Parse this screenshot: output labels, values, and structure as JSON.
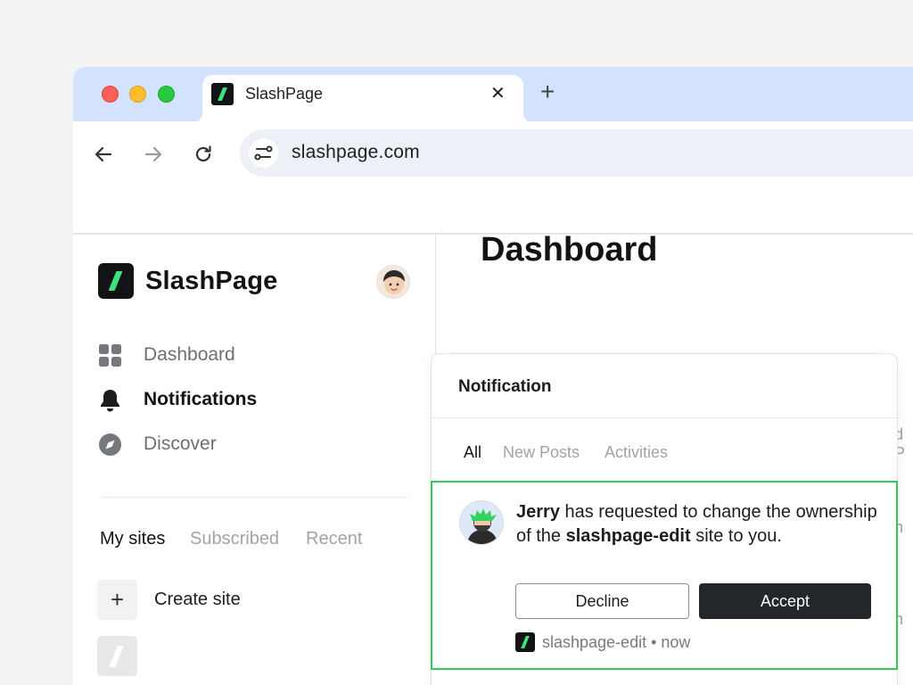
{
  "browser": {
    "tab_title": "SlashPage",
    "tab_close": "✕",
    "new_tab": "+",
    "url": "slashpage.com"
  },
  "sidebar": {
    "brand": "SlashPage",
    "nav": [
      {
        "label": "Dashboard",
        "icon": "grid-icon",
        "active": false
      },
      {
        "label": "Notifications",
        "icon": "bell-icon",
        "active": true
      },
      {
        "label": "Discover",
        "icon": "compass-icon",
        "active": false
      }
    ],
    "site_tabs": [
      {
        "label": "My sites",
        "active": true
      },
      {
        "label": "Subscribed",
        "active": false
      },
      {
        "label": "Recent",
        "active": false
      }
    ],
    "create_icon": "+",
    "create_label": "Create site"
  },
  "main": {
    "title": "Dashboard",
    "edge_fragments": [
      "d P",
      "n",
      "n"
    ]
  },
  "notifications": {
    "title": "Notification",
    "tabs": [
      {
        "label": "All",
        "active": true
      },
      {
        "label": "New Posts",
        "active": false
      },
      {
        "label": "Activities",
        "active": false
      }
    ],
    "item": {
      "user": "Jerry",
      "text_1": " has requested to change the ownership of the ",
      "site": "slashpage-edit",
      "text_2": " site to you.",
      "decline_label": "Decline",
      "accept_label": "Accept",
      "meta": "slashpage-edit • now"
    }
  },
  "colors": {
    "accent_green": "#3ee27a",
    "highlight_border": "#35c95a",
    "tabstrip": "#d3e3fd",
    "dark": "#23262b"
  }
}
